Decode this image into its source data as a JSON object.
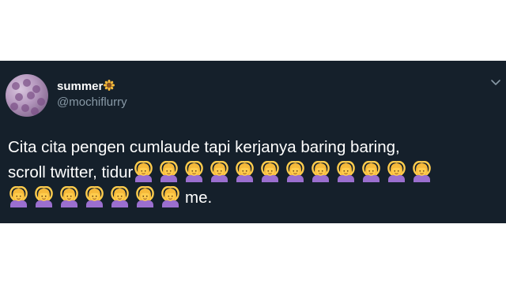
{
  "tweet": {
    "display_name": "summer",
    "name_badge_icon": "sunflower-icon",
    "handle": "@mochiflurry",
    "text_line_1": "Cita cita pengen cumlaude tapi kerjanya baring baring,",
    "text_line_2": "scroll twitter, tidur",
    "text_line_3_end": "me.",
    "emoji_icon": "woman-gesturing-ok-icon",
    "emoji_count_line_2": 12,
    "emoji_count_line_3": 7,
    "menu_icon": "chevron-down-icon"
  },
  "colors": {
    "card_background": "#15202b",
    "text": "#ffffff",
    "secondary_text": "#8899a6",
    "emoji_hair": "#f5b93a",
    "emoji_skin": "#ffcc4d",
    "emoji_shirt": "#9b6fcf"
  }
}
